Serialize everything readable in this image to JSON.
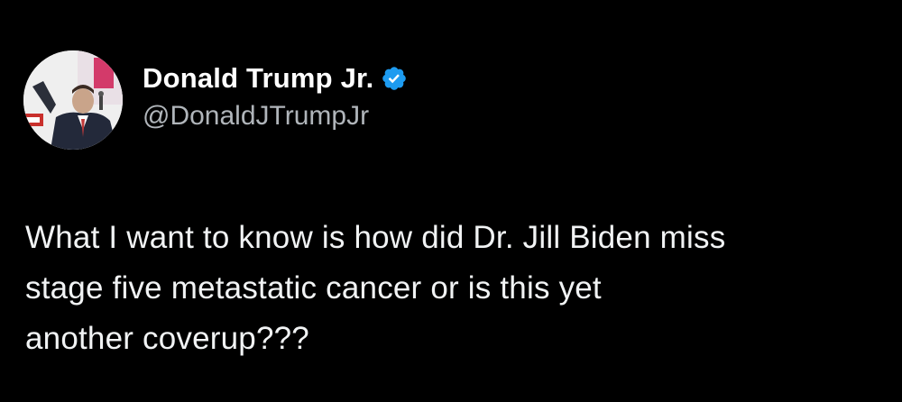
{
  "tweet": {
    "author": {
      "display_name": "Donald Trump Jr.",
      "handle": "@DonaldJTrumpJr",
      "verified": true,
      "avatar_icon": "profile-photo",
      "verified_icon": "verified-badge-icon"
    },
    "text_lines": [
      "What I want to know is how did Dr. Jill Biden miss",
      "stage five metastatic cancer or is this yet",
      "another coverup???"
    ]
  },
  "colors": {
    "background": "#000000",
    "name": "#ffffff",
    "handle": "#b0b5ba",
    "text": "#f1f3f4",
    "verified_blue": "#1d9bf0"
  }
}
